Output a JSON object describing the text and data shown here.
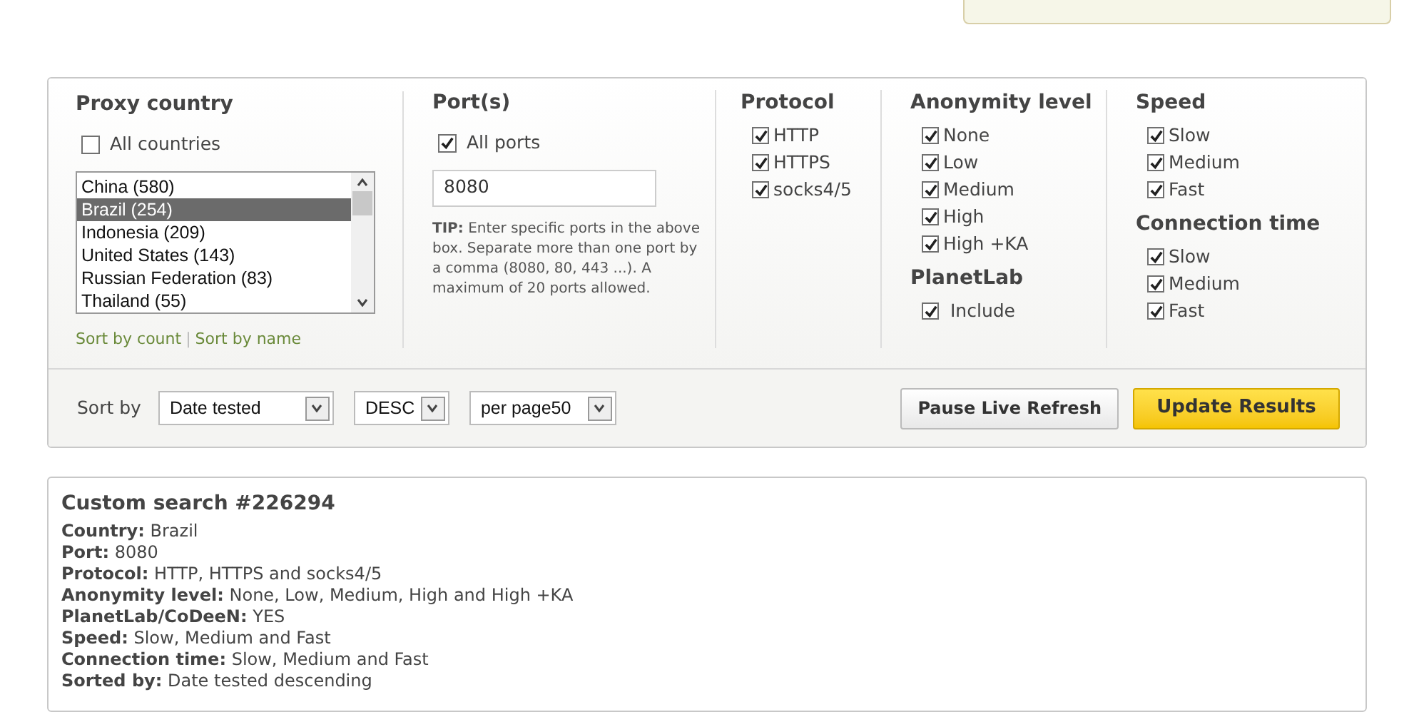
{
  "country": {
    "title": "Proxy country",
    "all": {
      "label": "All countries",
      "checked": false
    },
    "options": [
      {
        "label": "China (580)",
        "selected": false
      },
      {
        "label": "Brazil (254)",
        "selected": true
      },
      {
        "label": "Indonesia (209)",
        "selected": false
      },
      {
        "label": "United States (143)",
        "selected": false
      },
      {
        "label": "Russian Federation (83)",
        "selected": false
      },
      {
        "label": "Thailand (55)",
        "selected": false
      }
    ],
    "sort_links": [
      "Sort by count",
      "Sort by name"
    ],
    "sort_separator": "|"
  },
  "ports": {
    "title": "Port(s)",
    "all": {
      "label": "All ports",
      "checked": true
    },
    "value": "8080",
    "tip_label": "TIP:",
    "tip": "Enter specific ports in the above box. Separate more than one port by a comma (8080, 80, 443 ...). A maximum of 20 ports allowed."
  },
  "protocol": {
    "title": "Protocol",
    "options": [
      {
        "label": "HTTP",
        "checked": true
      },
      {
        "label": "HTTPS",
        "checked": true
      },
      {
        "label": "socks4/5",
        "checked": true
      }
    ]
  },
  "anonymity": {
    "title": "Anonymity level",
    "options": [
      {
        "label": "None",
        "checked": true
      },
      {
        "label": "Low",
        "checked": true
      },
      {
        "label": "Medium",
        "checked": true
      },
      {
        "label": "High",
        "checked": true
      },
      {
        "label": "High +KA",
        "checked": true
      }
    ]
  },
  "planetlab": {
    "title": "PlanetLab",
    "options": [
      {
        "label": "Include",
        "checked": true
      }
    ]
  },
  "speed": {
    "title": "Speed",
    "options": [
      {
        "label": "Slow",
        "checked": true
      },
      {
        "label": "Medium",
        "checked": true
      },
      {
        "label": "Fast",
        "checked": true
      }
    ]
  },
  "connection_time": {
    "title": "Connection time",
    "options": [
      {
        "label": "Slow",
        "checked": true
      },
      {
        "label": "Medium",
        "checked": true
      },
      {
        "label": "Fast",
        "checked": true
      }
    ]
  },
  "sort_bar": {
    "label": "Sort by",
    "sort_field": "Date tested",
    "order": "DESC",
    "per_page": "per page50",
    "pause_button": "Pause Live Refresh",
    "update_button": "Update Results"
  },
  "summary": {
    "title": "Custom search #226294",
    "lines": [
      {
        "label": "Country:",
        "value": "Brazil"
      },
      {
        "label": "Port:",
        "value": "8080"
      },
      {
        "label": "Protocol:",
        "value": "HTTP, HTTPS and socks4/5"
      },
      {
        "label": "Anonymity level:",
        "value": "None, Low, Medium, High and High +KA"
      },
      {
        "label": "PlanetLab/CoDeeN:",
        "value": "YES"
      },
      {
        "label": "Speed:",
        "value": "Slow, Medium and Fast"
      },
      {
        "label": "Connection time:",
        "value": "Slow, Medium and Fast"
      },
      {
        "label": "Sorted by:",
        "value": "Date tested descending"
      }
    ]
  }
}
